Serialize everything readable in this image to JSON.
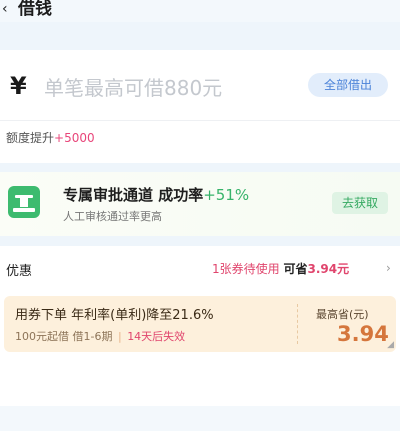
{
  "header": {
    "back_icon": "chevron-left-icon",
    "title": "借钱"
  },
  "amount_card": {
    "currency": "¥",
    "placeholder": "单笔最高可借880元",
    "borrow_all_label": "全部借出",
    "quota_prefix": "额度提升",
    "quota_plus": "+5000"
  },
  "channel_card": {
    "icon": "stamp-icon",
    "title": "专属审批通道 成功率",
    "rate": "+51%",
    "subtitle": "人工审核通过率更高",
    "button_label": "去获取"
  },
  "discount_card": {
    "label": "优惠",
    "pending": "1张券待使用",
    "save_label": "可省",
    "save_value": "3.94元",
    "chevron": "›",
    "coupon": {
      "title": "用券下单 年利率(单利)降至21.6%",
      "min_amount": "100元起借",
      "terms": "借1-6期",
      "separator": "|",
      "expiry": "14天后失效",
      "max_save_label": "最高省(元)",
      "max_save_value": "3.94"
    }
  },
  "colors": {
    "accent_blue": "#4a82d8",
    "accent_green": "#36b36a",
    "accent_pink": "#e0456d",
    "coupon_bg": "#fdf0dc"
  }
}
